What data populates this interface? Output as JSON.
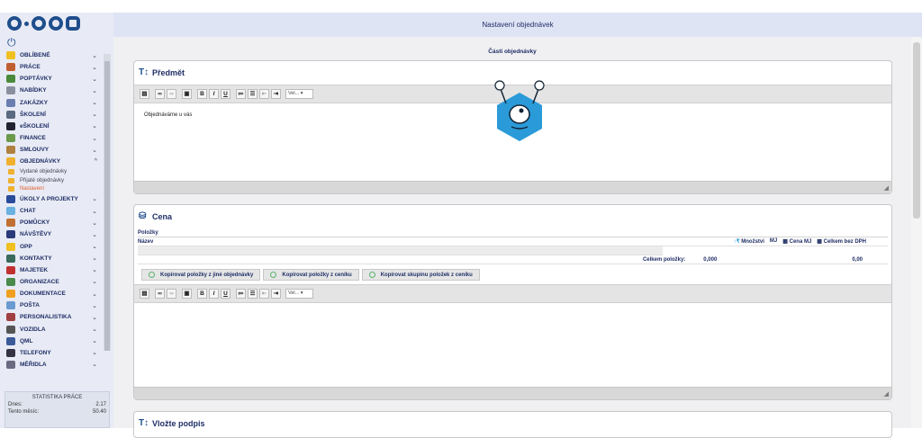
{
  "app": {
    "title": "Nastavení objednávek"
  },
  "menu": [
    {
      "label": "OBLÍBENÉ",
      "icon": "star-icon",
      "color": "#f0c020",
      "chev": "⌄"
    },
    {
      "label": "PRÁCE",
      "icon": "briefcase-icon",
      "color": "#c06030",
      "chev": "⌄"
    },
    {
      "label": "POPTÁVKY",
      "icon": "lightbulb-icon",
      "color": "#4a8a3a",
      "chev": "⌄"
    },
    {
      "label": "NABÍDKY",
      "icon": "document-icon",
      "color": "#8a8fa0",
      "chev": "⌄"
    },
    {
      "label": "ZAKÁZKY",
      "icon": "calendar-icon",
      "color": "#6a7fb0",
      "chev": "⌄"
    },
    {
      "label": "ŠKOLENÍ",
      "icon": "presentation-icon",
      "color": "#5a6a80",
      "chev": "⌄"
    },
    {
      "label": "eŠKOLENÍ",
      "icon": "graduation-cap-icon",
      "color": "#223",
      "chev": "⌄"
    },
    {
      "label": "FINANCE",
      "icon": "money-icon",
      "color": "#6a9a4a",
      "chev": "⌄"
    },
    {
      "label": "SMLOUVY",
      "icon": "handshake-icon",
      "color": "#b08040",
      "chev": "⌄"
    },
    {
      "label": "OBJEDNÁVKY",
      "icon": "cart-icon",
      "color": "#f0b030",
      "chev": "^"
    }
  ],
  "submenu": [
    {
      "label": "Vydané objednávky",
      "active": false
    },
    {
      "label": "Přijaté objednávky",
      "active": false
    },
    {
      "label": "Nastavení",
      "active": true
    }
  ],
  "menu2": [
    {
      "label": "ÚKOLY A PROJEKTY",
      "icon": "checkbox-icon",
      "color": "#2a4a9a",
      "chev": "⌄"
    },
    {
      "label": "CHAT",
      "icon": "chat-icon",
      "color": "#6ab0e0",
      "chev": "⌄"
    },
    {
      "label": "POMŮCKY",
      "icon": "toolbox-icon",
      "color": "#c07030",
      "chev": "⌄"
    },
    {
      "label": "NÁVŠTĚVY",
      "icon": "person-walking-icon",
      "color": "#2a3a7a",
      "chev": "⌄"
    },
    {
      "label": "OPP",
      "icon": "safety-helmet-icon",
      "color": "#f0c020",
      "chev": "⌄"
    },
    {
      "label": "KONTAKTY",
      "icon": "address-book-icon",
      "color": "#3a6a5a",
      "chev": "⌄"
    },
    {
      "label": "MAJETEK",
      "icon": "car-icon",
      "color": "#c03030",
      "chev": "⌄"
    },
    {
      "label": "ORGANIZACE",
      "icon": "building-icon",
      "color": "#4a8a4a",
      "chev": "⌄"
    },
    {
      "label": "DOKUMENTACE",
      "icon": "bulb-icon",
      "color": "#f0a020",
      "chev": "⌄"
    },
    {
      "label": "POŠTA",
      "icon": "mail-icon",
      "color": "#6a9ad0",
      "chev": "⌄"
    },
    {
      "label": "PERSONALISTIKA",
      "icon": "people-icon",
      "color": "#a04040",
      "chev": "⌄"
    },
    {
      "label": "VOZIDLA",
      "icon": "vehicle-icon",
      "color": "#555",
      "chev": "⌄"
    },
    {
      "label": "QML",
      "icon": "qml-icon",
      "color": "#3a5a9a",
      "chev": "⌄"
    },
    {
      "label": "TELEFONY",
      "icon": "phone-icon",
      "color": "#334",
      "chev": "⌄"
    },
    {
      "label": "MĚŘIDLA",
      "icon": "ruler-icon",
      "color": "#6a6a80",
      "chev": "⌄"
    }
  ],
  "stats": {
    "title": "STATISTIKA PRÁCE",
    "rows": [
      {
        "label": "Dnes:",
        "value": "2.17"
      },
      {
        "label": "Tento měsíc:",
        "value": "50.40"
      }
    ]
  },
  "main": {
    "section_title": "Části objednávky"
  },
  "predmet": {
    "title": "Předmět",
    "text": "Objednáváme u vás",
    "font_select": "Vel..."
  },
  "cena": {
    "title": "Cena",
    "items_label": "Položky",
    "cols": {
      "name": "Název",
      "qty": "Množství",
      "unit": "MJ",
      "unit_price": "Cena MJ",
      "total": "Celkem bez DPH"
    },
    "sum_label": "Celkem položky:",
    "sum_qty": "0,000",
    "sum_total": "0,00",
    "btn_other_order": "Kopírovat položky z jiné objednávky",
    "btn_pricelist": "Kopírovat položky z ceníku",
    "btn_group": "Kopírovat skupinu položek z ceníku",
    "font_select": "Vel..."
  },
  "podpis": {
    "title": "Vložte podpis"
  },
  "colors": {
    "brand": "#1f4e8c",
    "accent": "#2b9ad8",
    "active": "#e05a2a"
  }
}
